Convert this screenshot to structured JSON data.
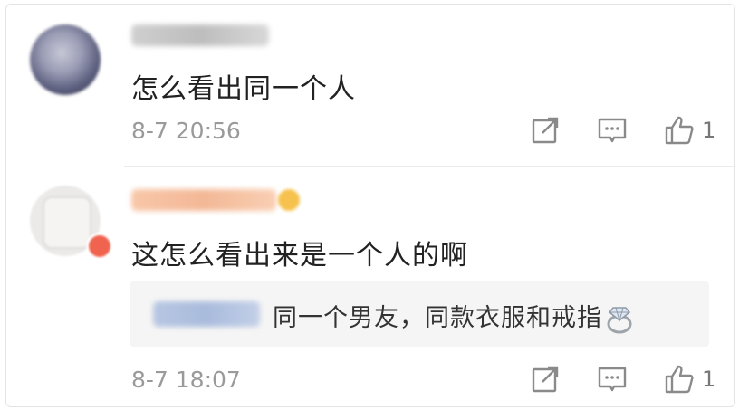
{
  "comments": [
    {
      "text": "怎么看出同一个人",
      "timestamp": "8-7 20:56",
      "likes": "1"
    },
    {
      "text": "这怎么看出来是一个人的啊",
      "timestamp": "8-7 18:07",
      "likes": "1",
      "reply": {
        "text": "同一个男友，同款衣服和戒指"
      }
    }
  ],
  "colors": {
    "text": "#222222",
    "meta": "#9a9a9a",
    "reply_bg": "#f5f5f5",
    "divider": "#ececec"
  },
  "icons": [
    "share-icon",
    "comment-icon",
    "like-icon",
    "ring-emoji"
  ]
}
